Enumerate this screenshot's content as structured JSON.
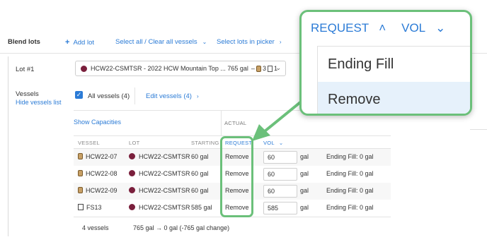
{
  "header": {
    "title": "Blend lots",
    "add_lot": "Add lot",
    "select_all": "Select all / Clear all vessels",
    "select_in_picker": "Select lots in picker"
  },
  "lot": {
    "label": "Lot #1",
    "select_value": "HCW22-CSMTSR - 2022 HCW Mountain Top ... 765 gal",
    "barrel_count": "3",
    "tank_count": "1"
  },
  "vessels": {
    "label": "Vessels",
    "hide_link": "Hide vessels list",
    "all_vessels": "All vessels (4)",
    "edit_vessels": "Edit vessels (4)"
  },
  "table": {
    "show_capacities": "Show Capacities",
    "actual_label": "ACTUAL",
    "headers": {
      "vessel": "VESSEL",
      "lot": "LOT",
      "starting": "STARTING",
      "request": "REQUEST",
      "vol": "VOL"
    },
    "rows": [
      {
        "vessel": "HCW22-07",
        "lot": "HCW22-CSMTSR",
        "starting": "60 gal",
        "request": "Remove",
        "vol": "60",
        "unit": "gal",
        "ending": "Ending Fill: 0 gal"
      },
      {
        "vessel": "HCW22-08",
        "lot": "HCW22-CSMTSR",
        "starting": "60 gal",
        "request": "Remove",
        "vol": "60",
        "unit": "gal",
        "ending": "Ending Fill: 0 gal"
      },
      {
        "vessel": "HCW22-09",
        "lot": "HCW22-CSMTSR",
        "starting": "60 gal",
        "request": "Remove",
        "vol": "60",
        "unit": "gal",
        "ending": "Ending Fill: 0 gal"
      },
      {
        "vessel": "FS13",
        "lot": "HCW22-CSMTSR",
        "starting": "585 gal",
        "request": "Remove",
        "vol": "585",
        "unit": "gal",
        "ending": "Ending Fill: 0 gal"
      }
    ],
    "footer_count": "4 vessels",
    "footer_change": "765 gal → 0 gal (-765 gal change)"
  },
  "popup": {
    "header_request": "REQUEST",
    "header_vol": "VOL",
    "menu": [
      "Ending Fill",
      "Remove"
    ]
  },
  "colors": {
    "accent": "#2b7bd6",
    "highlight": "#6bc07a",
    "lot_dot": "#7a1f3c"
  }
}
